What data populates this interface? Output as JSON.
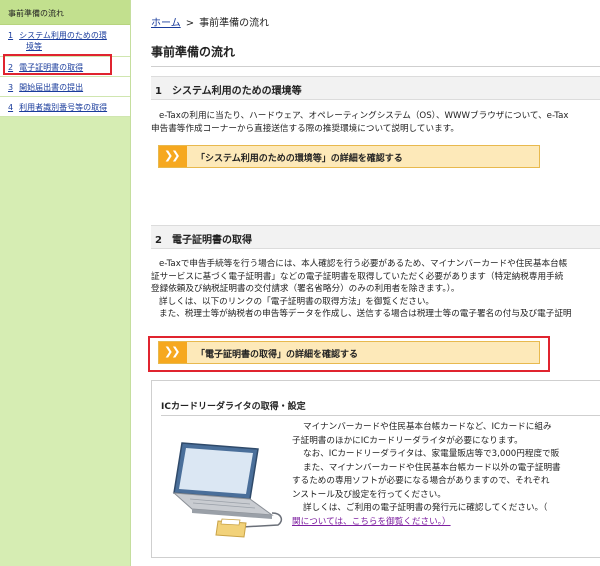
{
  "sidebar": {
    "title": "事前準備の流れ",
    "items": [
      {
        "num": "1",
        "label_line1": "システム利用のための環",
        "label_line2": "境等"
      },
      {
        "num": "2",
        "label": "電子証明書の取得"
      },
      {
        "num": "3",
        "label": "開始届出書の提出"
      },
      {
        "num": "4",
        "label": "利用者識別番号等の取得"
      }
    ]
  },
  "breadcrumb": {
    "home": "ホーム",
    "separator": ">",
    "current": "事前準備の流れ"
  },
  "page_title": "事前準備の流れ",
  "section1": {
    "heading": "1　システム利用のための環境等",
    "lines": [
      "e-Taxの利用に当たり、ハードウェア、オペレーティングシステム（OS）、WWWブラウザについて、e-Tax",
      "申告書等作成コーナーから直接送信する際の推奨環境について説明しています。"
    ],
    "cta_label": "「システム利用のための環境等」の詳細を確認する"
  },
  "section2": {
    "heading": "2　電子証明書の取得",
    "lines": [
      "e-Taxで申告手続等を行う場合には、本人確認を行う必要があるため、マイナンバーカードや住民基本台帳",
      "証サービスに基づく電子証明書」などの電子証明書を取得していただく必要があります（特定納税専用手続",
      "登録依頼及び納税証明書の交付請求（署名省略分）のみの利用者を除きます。）。",
      "詳しくは、以下のリンクの「電子証明書の取得方法」を御覧ください。",
      "また、税理士等が納税者の申告等データを作成し、送信する場合は税理士等の電子署名の付与及び電子証明"
    ],
    "cta_label": "「電子証明書の取得」の詳細を確認する"
  },
  "ic_box": {
    "title": "ICカードリーダライタの取得・設定",
    "lines": [
      "マイナンバーカードや住民基本台帳カードなど、ICカードに組み",
      "子証明書のほかにICカードリーダライタが必要になります。",
      "なお、ICカードリーダライタは、家電量販店等で3,000円程度で販",
      "また、マイナンバーカードや住民基本台帳カード以外の電子証明書",
      "するための専用ソフトが必要になる場合がありますので、それぞれ",
      "ンストール及び設定を行ってください。",
      "詳しくは、ご利用の電子証明書の発行元に確認してください。（",
      "関については、こちらを御覧ください。）"
    ]
  },
  "colors": {
    "sidebar_bg": "#d6edb3",
    "link": "#1a3c9c",
    "cta_bg": "#fde9b9",
    "cta_accent": "#f6a81f",
    "highlight": "#e0242f"
  }
}
